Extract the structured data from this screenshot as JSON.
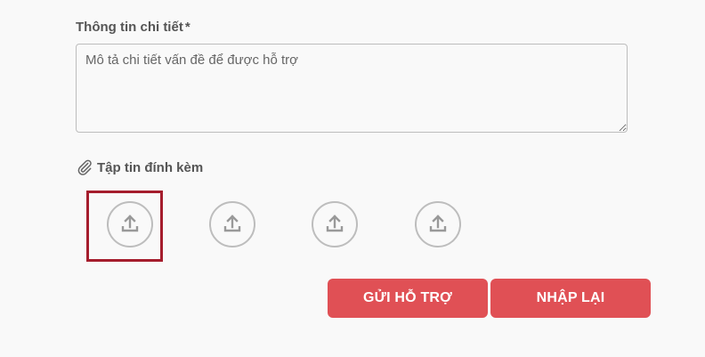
{
  "details": {
    "label": "Thông tin chi tiết",
    "required_mark": "*",
    "placeholder": "Mô tả chi tiết vấn đề để được hỗ trợ",
    "value": ""
  },
  "attachments": {
    "label": "Tập tin đính kèm",
    "icon": "paperclip-icon",
    "slots": [
      {
        "icon": "upload-icon",
        "selected": true
      },
      {
        "icon": "upload-icon",
        "selected": false
      },
      {
        "icon": "upload-icon",
        "selected": false
      },
      {
        "icon": "upload-icon",
        "selected": false
      }
    ]
  },
  "actions": {
    "submit_label": "GỬI HỖ TRỢ",
    "reset_label": "NHẬP LẠI"
  },
  "colors": {
    "background": "#f9f9f9",
    "button": "#e05055",
    "selection_frame": "#a51d2d",
    "icon_gray": "#bdbdbd",
    "text": "#555555"
  }
}
